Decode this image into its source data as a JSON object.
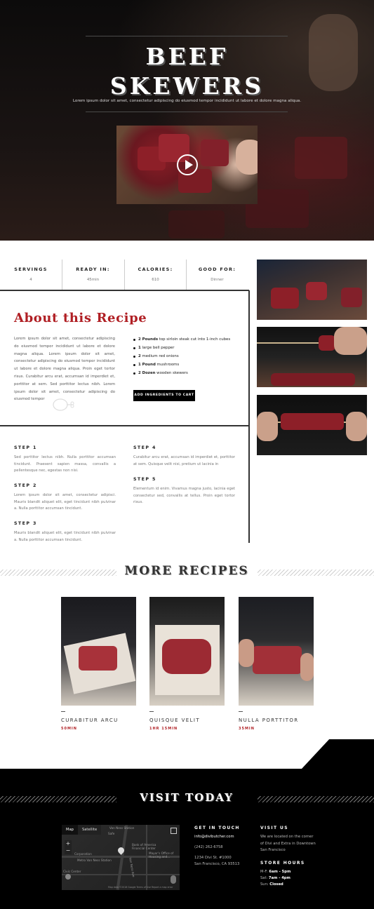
{
  "hero": {
    "title_line1": "BEEF",
    "title_line2": "SKEWERS",
    "subtitle": "Lorem ipsum dolor sit amet, consectetur adipiscing do eiusmod tempor incididunt ut labore et dolore magna aliqua."
  },
  "stats": [
    {
      "label": "SERVINGS",
      "value": "4"
    },
    {
      "label": "READY IN:",
      "value": "45min"
    },
    {
      "label": "CALORIES:",
      "value": "610"
    },
    {
      "label": "GOOD FOR:",
      "value": "Dinner"
    }
  ],
  "about": {
    "title": "About this Recipe",
    "text": "Lorem ipsum dolor sit amet, consectetur adipiscing do eiusmod tempor incididunt ut labore et dolore magna aliqua. Lorem ipsum dolor sit amet, consectetur adipiscing do eiusmod tempor incididunt ut labore et dolore magna aliqua. Proin eget tortor risus. Curabitur arcu erat, accumsan id imperdiet et, porttitor at sem. Sed porttitor lectus nibh. Lorem ipsum dolor sit amet, consectetur adipiscing do eiusmod tempor",
    "ingredients": [
      {
        "qty": "2 Pounds",
        "item": "top sirloin steak cut into 1-inch cubes"
      },
      {
        "qty": "1",
        "item": "large bell pepper"
      },
      {
        "qty": "2",
        "item": "medium red onions"
      },
      {
        "qty": "1 Pound",
        "item": "mushrooms"
      },
      {
        "qty": "2 Dozen",
        "item": "wooden skewers"
      }
    ],
    "cart_button": "ADD INGREDIENTS TO CART"
  },
  "steps": [
    {
      "heading": "STEP 1",
      "text": "Sed porttitor lectus nibh. Nulla porttitor accumsan tincidunt. Praesent sapien massa, convallis a pellentesque nec, egestas non nisi."
    },
    {
      "heading": "STEP 2",
      "text": "Lorem ipsum dolor sit amet, consectetur adipisci. Mauris blandit aliquet elit, eget tincidunt nibh pulvinar a. Nulla porttitor accumsan tincidunt."
    },
    {
      "heading": "STEP 3",
      "text": "Mauris blandit aliquet elit, eget tincidunt nibh pulvinar a. Nulla porttitor accumsan tincidunt."
    },
    {
      "heading": "STEP 4",
      "text": "Curabitur arcu erat, accumsan id imperdiet et, porttitor at sem. Quisque velit nisi, pretium ut lacinia in"
    },
    {
      "heading": "STEP 5",
      "text": "Elementum id enim. Vivamus magna justo, lacinia eget consectetur sed, convallis at tellus. Proin eget tortor risus."
    }
  ],
  "more": {
    "title": "MORE RECIPES",
    "cards": [
      {
        "title": "CURABITUR ARCU",
        "time": "50MIN"
      },
      {
        "title": "QUISQUE VELIT",
        "time": "1HR 15MIN"
      },
      {
        "title": "NULLA PORTTITOR",
        "time": "35MIN"
      }
    ]
  },
  "footer": {
    "title": "VISIT TODAY",
    "map": {
      "tab_map": "Map",
      "tab_satellite": "Satellite",
      "labels": [
        "Van Ness Station",
        "Safe",
        "Bank of America Financial Center",
        "Mayor's Office of Housing and...",
        "Corporation",
        "Metro Van Ness Station",
        "Civic Center",
        "Van Ness Ave"
      ],
      "footer_note": "Map data ©2018 Google   Terms of Use   Report a map error"
    },
    "get_in_touch": {
      "heading": "GET IN TOUCH",
      "email": "info@divibutcher.com",
      "phone": "(242) 262-6758",
      "address1": "1234 Divi St. #1000",
      "address2": "San Francisco, CA 93513"
    },
    "visit_us": {
      "heading": "VISIT US",
      "text": "We are located on the corner of Divi and Extra in Downtown San Francisco"
    },
    "hours": {
      "heading": "STORE HOURS",
      "rows": [
        {
          "day": "M-F:",
          "time": "6am - 5pm"
        },
        {
          "day": "Sat:",
          "time": "7am - 4pm"
        },
        {
          "day": "Sun:",
          "time": "Closed"
        }
      ]
    }
  },
  "colors": {
    "accent": "#b01f24",
    "dark": "#000000"
  }
}
